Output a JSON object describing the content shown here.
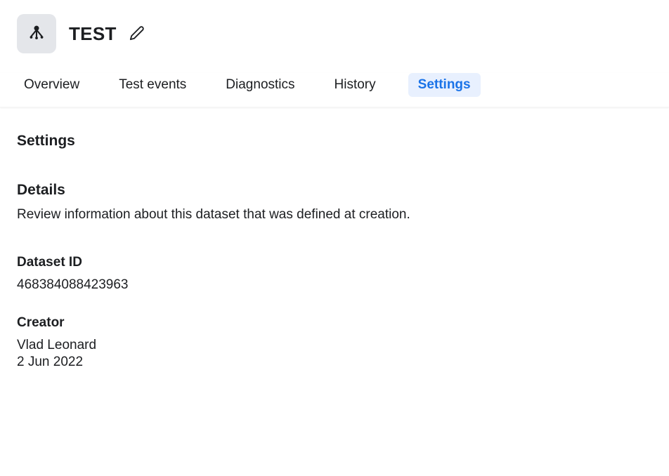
{
  "header": {
    "title": "TEST"
  },
  "tabs": {
    "overview": "Overview",
    "test_events": "Test events",
    "diagnostics": "Diagnostics",
    "history": "History",
    "settings": "Settings"
  },
  "settings": {
    "heading": "Settings",
    "details": {
      "heading": "Details",
      "description": "Review information about this dataset that was defined at creation.",
      "dataset_id_label": "Dataset ID",
      "dataset_id_value": "468384088423963",
      "creator_label": "Creator",
      "creator_name": "Vlad Leonard",
      "creator_date": "2 Jun 2022"
    }
  }
}
